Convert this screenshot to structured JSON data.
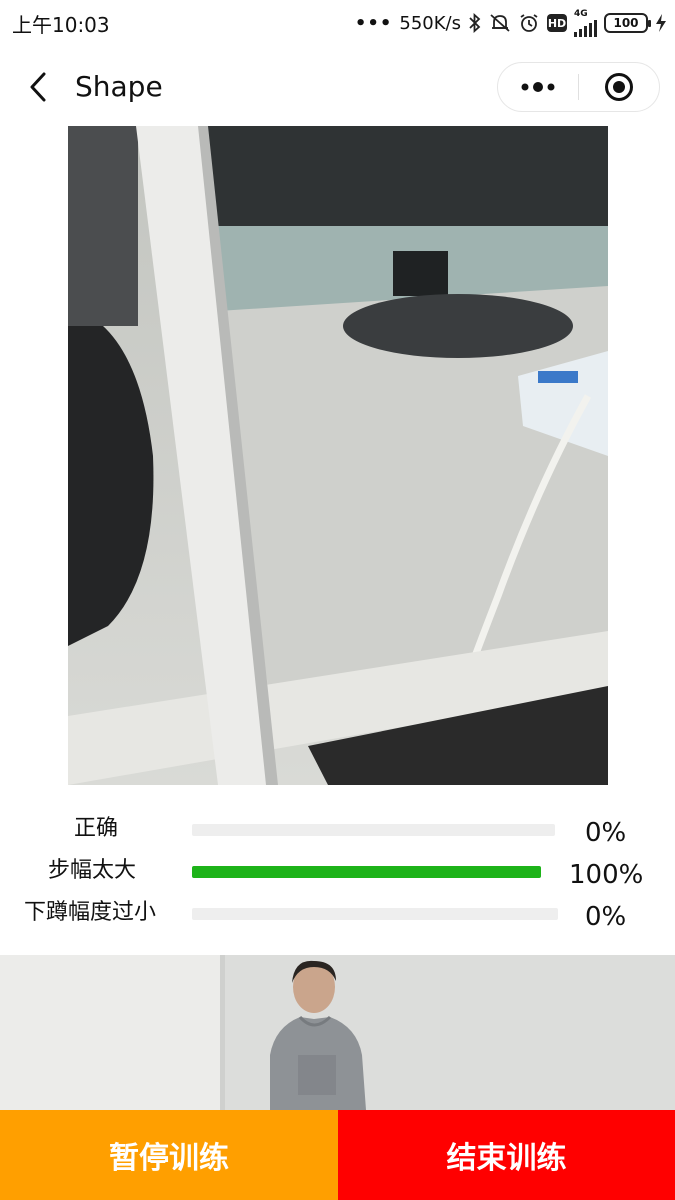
{
  "status_bar": {
    "time": "上午10:03",
    "network_speed": "550K/s",
    "network_type": "4G",
    "hd_label": "HD",
    "battery_level": "100",
    "icons": [
      "bluetooth-icon",
      "mute-icon",
      "alarm-icon",
      "hd-icon",
      "signal-icon",
      "battery-icon",
      "charging-icon"
    ]
  },
  "nav": {
    "title": "Shape",
    "icons": [
      "back-icon",
      "more-icon",
      "close-target-icon"
    ]
  },
  "feedback": [
    {
      "label": "正确",
      "value_text": "0%",
      "percent": 0
    },
    {
      "label": "步幅太大",
      "value_text": "100%",
      "percent": 100
    },
    {
      "label": "下蹲幅度过小",
      "value_text": "0%",
      "percent": 0
    }
  ],
  "actions": {
    "pause_label": "暂停训练",
    "end_label": "结束训练"
  },
  "colors": {
    "progress_fill": "#1db319",
    "progress_track": "#eeeeee",
    "pause_button": "#ff9f00",
    "end_button": "#ff0000"
  }
}
